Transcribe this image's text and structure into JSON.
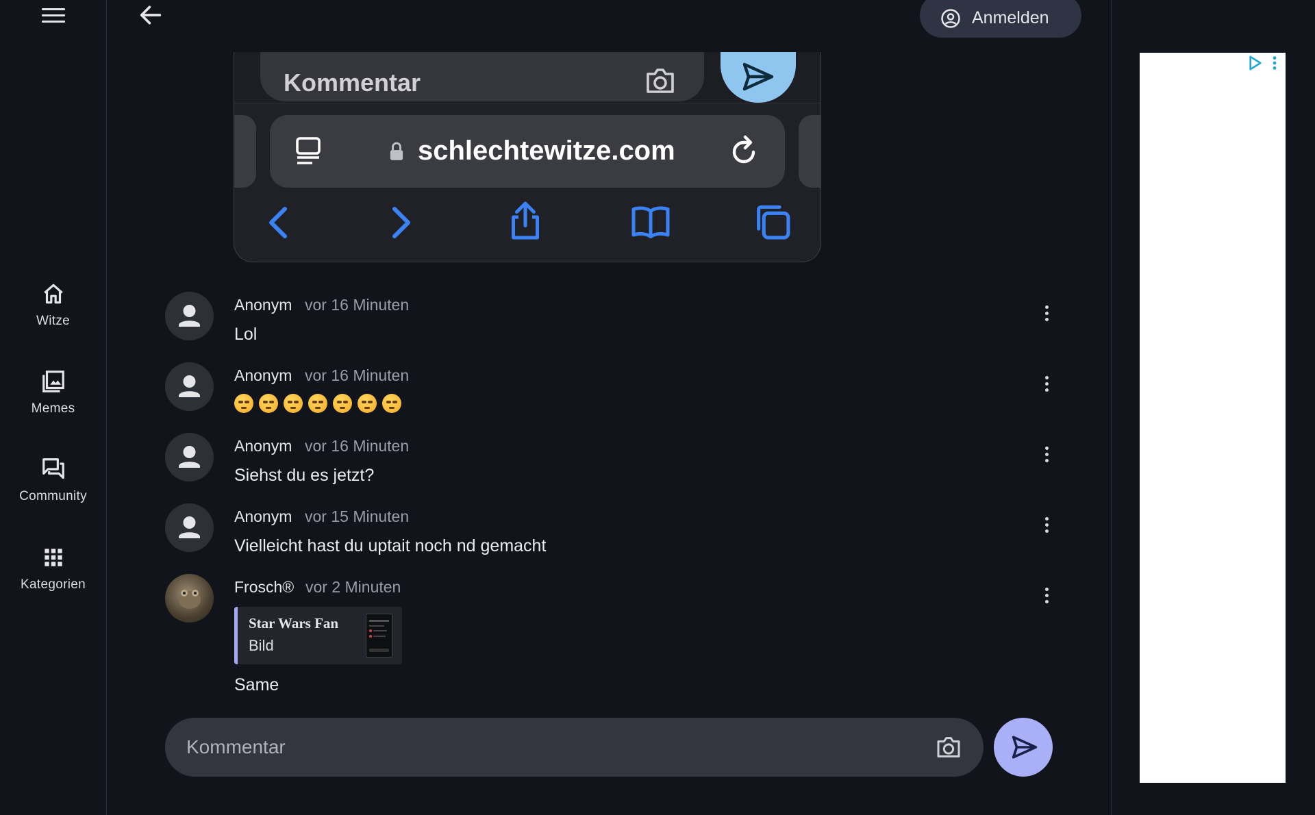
{
  "nav": {
    "items": [
      {
        "label": "Witze",
        "icon": "home-icon"
      },
      {
        "label": "Memes",
        "icon": "image-gallery-icon"
      },
      {
        "label": "Community",
        "icon": "forum-icon"
      },
      {
        "label": "Kategorien",
        "icon": "grid-icon"
      }
    ]
  },
  "header": {
    "login_label": "Anmelden"
  },
  "attachment_screenshot": {
    "comment_placeholder": "Kommentar",
    "url": "schlechtewitze.com"
  },
  "comments": [
    {
      "author": "Anonym",
      "time": "vor 16 Minuten",
      "text": "Lol"
    },
    {
      "author": "Anonym",
      "time": "vor 16 Minuten",
      "text": "",
      "emoji_count": 7
    },
    {
      "author": "Anonym",
      "time": "vor 16 Minuten",
      "text": "Siehst du es jetzt?"
    },
    {
      "author": "Anonym",
      "time": "vor 15 Minuten",
      "text": "Vielleicht hast du uptait noch nd gemacht"
    },
    {
      "author": "Frosch®",
      "time": "vor 2 Minuten",
      "reply": {
        "title": "Star Wars Fan",
        "subtitle": "Bild"
      },
      "text": "Same"
    }
  ],
  "composer": {
    "placeholder": "Kommentar"
  },
  "colors": {
    "background": "#12141b",
    "send_button": "#a9b0f7",
    "login_button": "#2e3444",
    "reply_accent": "#a5aaf0"
  }
}
